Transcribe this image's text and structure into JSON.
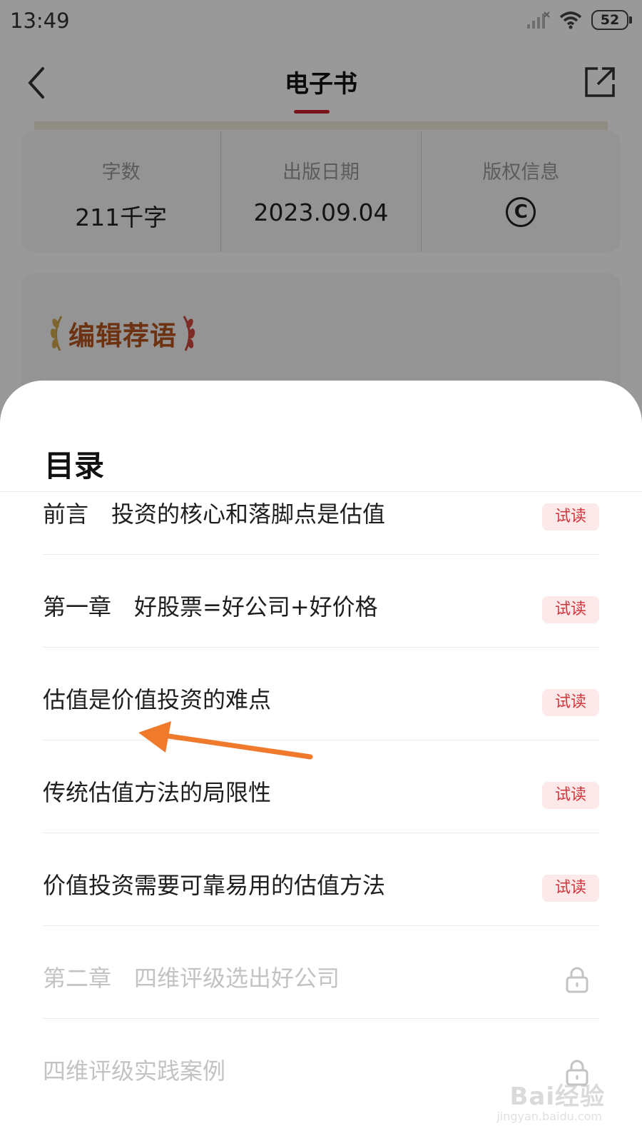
{
  "status_bar": {
    "time": "13:49",
    "battery": "52",
    "icons": [
      "signal-icon",
      "wifi-icon",
      "battery-icon"
    ]
  },
  "header": {
    "title": "电子书",
    "accent_color": "#c8202a"
  },
  "book_info": {
    "word_count_label": "字数",
    "word_count_value": "211千字",
    "publish_date_label": "出版日期",
    "publish_date_value": "2023.09.04",
    "copyright_label": "版权信息",
    "copyright_icon": "copyright-icon"
  },
  "editor_recommendation": {
    "title": "编辑荐语"
  },
  "toc": {
    "title": "目录",
    "items": [
      {
        "label": "前言　投资的核心和落脚点是估值",
        "badge": "试读",
        "locked": false
      },
      {
        "label": "第一章　好股票=好公司+好价格",
        "badge": "试读",
        "locked": false
      },
      {
        "label": "估值是价值投资的难点",
        "badge": "试读",
        "locked": false
      },
      {
        "label": "传统估值方法的局限性",
        "badge": "试读",
        "locked": false
      },
      {
        "label": "价值投资需要可靠易用的估值方法",
        "badge": "试读",
        "locked": false
      },
      {
        "label": "第二章　四维评级选出好公司",
        "badge": "",
        "locked": true
      },
      {
        "label": "四维评级实践案例",
        "badge": "",
        "locked": true
      }
    ]
  },
  "annotation": {
    "arrow_color": "#f07a2c"
  },
  "watermark": {
    "brand": "Bai经验",
    "site": "jingyan.baidu.com"
  }
}
